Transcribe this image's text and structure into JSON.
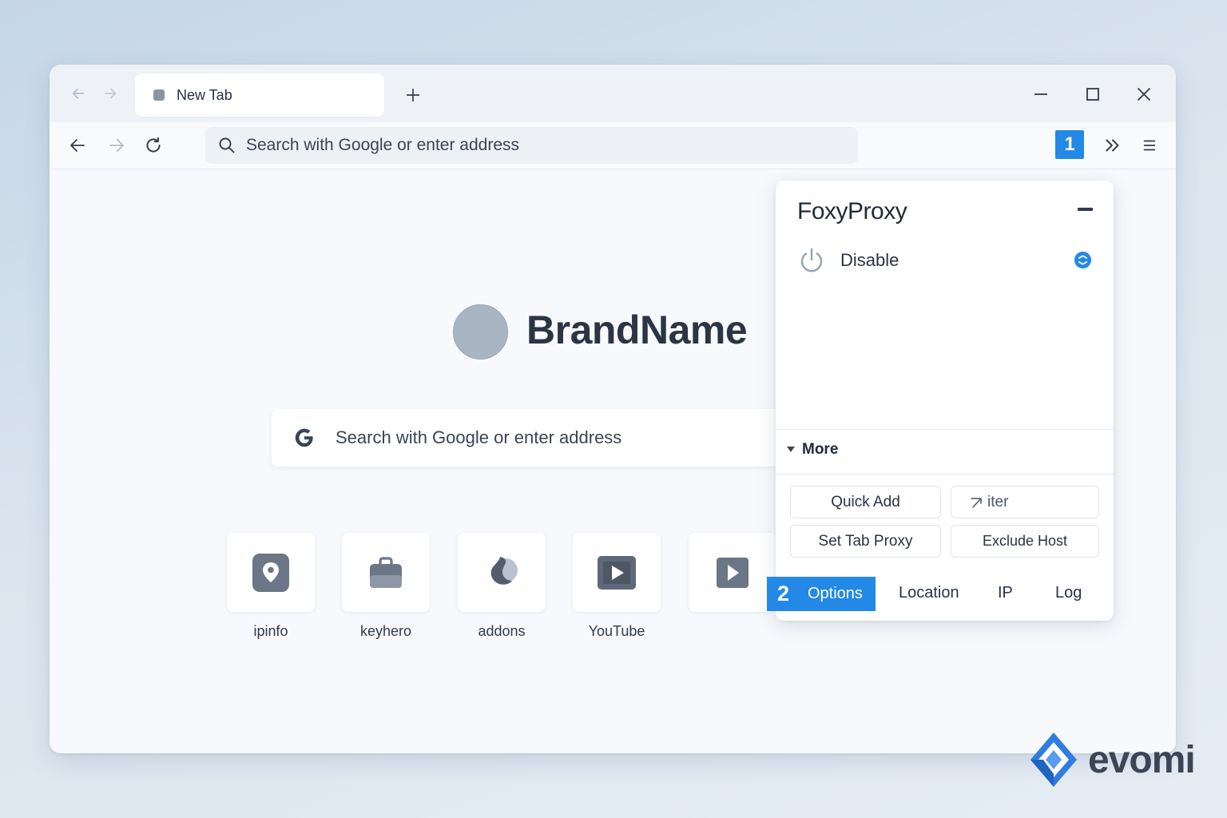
{
  "browser": {
    "tab": {
      "title": "New Tab"
    },
    "address_bar": {
      "placeholder": "Search with Google or enter address"
    },
    "extension_badge": "1"
  },
  "new_tab": {
    "brand": "BrandName",
    "search_placeholder": "Search with Google or enter address",
    "shortcuts": [
      {
        "label": "ipinfo",
        "icon": "location-pin-icon"
      },
      {
        "label": "keyhero",
        "icon": "briefcase-icon"
      },
      {
        "label": "addons",
        "icon": "puzzle-drop-icon"
      },
      {
        "label": "YouTube",
        "icon": "play-icon"
      },
      {
        "label": "",
        "icon": "play-icon"
      }
    ]
  },
  "popup": {
    "title": "FoxyProxy",
    "power_label": "Disable",
    "more_label": "More",
    "buttons": {
      "quick_add": "Quick Add",
      "filter": "iter",
      "set_tab_proxy": "Set Tab Proxy",
      "exclude_host": "Exclude Host"
    },
    "nav": {
      "options_step": "2",
      "options": "Options",
      "location": "Location",
      "ip": "IP",
      "log": "Log"
    }
  },
  "watermark": {
    "text": "evomi"
  },
  "colors": {
    "accent": "#2388e6",
    "text": "#2a3342",
    "background": "#dbe5ef"
  }
}
